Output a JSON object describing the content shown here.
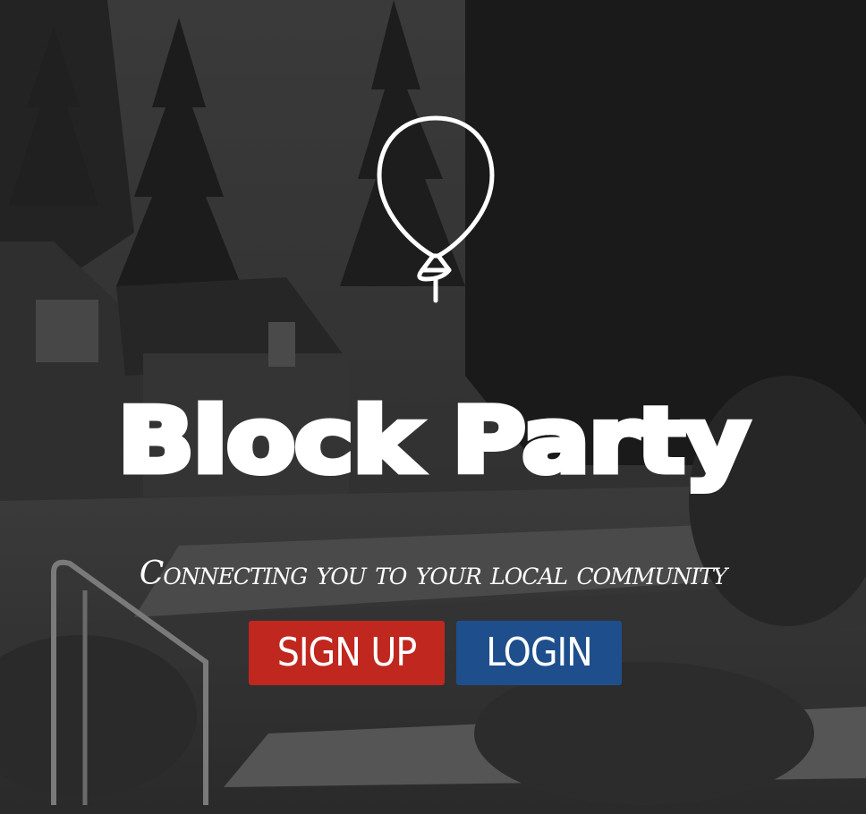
{
  "hero": {
    "logo_icon": "balloon-icon",
    "title": "Block Party",
    "tagline": "Connecting you to your local community"
  },
  "actions": {
    "signup_label": "SIGN UP",
    "login_label": "LOGIN"
  },
  "colors": {
    "signup_bg": "#c0271f",
    "login_bg": "#1e4f8c",
    "text": "#ffffff"
  }
}
